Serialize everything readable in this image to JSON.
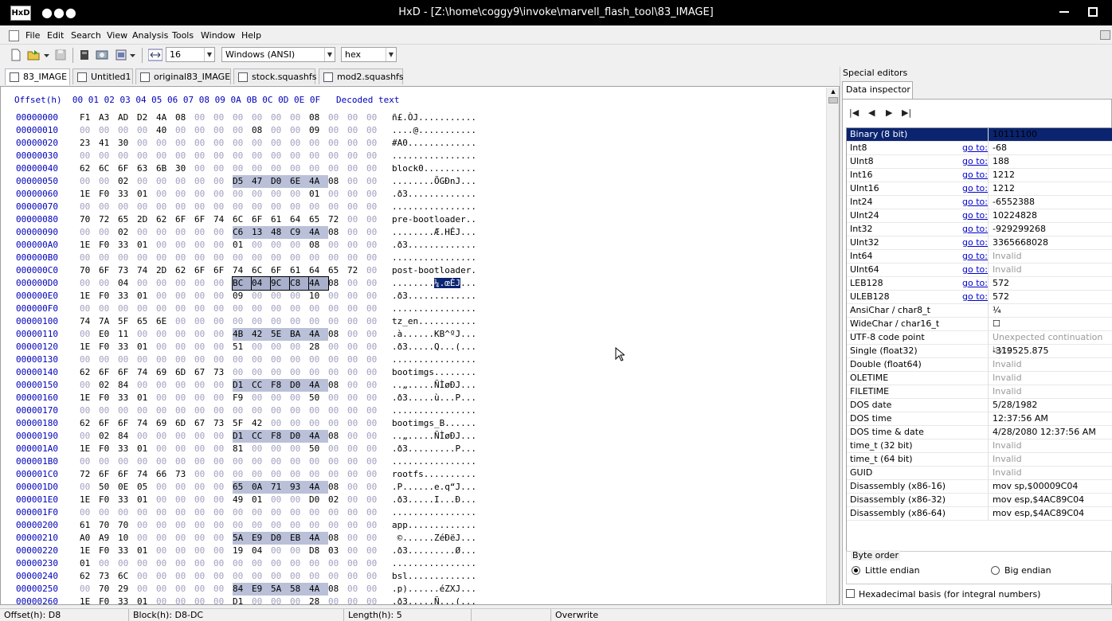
{
  "window": {
    "title": "HxD - [Z:\\home\\coggy9\\invoke\\marvell_flash_tool\\83_IMAGE]",
    "logo": "HxD"
  },
  "menu": [
    "File",
    "Edit",
    "Search",
    "View",
    "Analysis",
    "Tools",
    "Window",
    "Help"
  ],
  "toolbar": {
    "bytes_per_row": "16",
    "charset": "Windows (ANSI)",
    "offset_base": "hex"
  },
  "tabs": [
    "83_IMAGE",
    "Untitled1",
    "original83_IMAGE",
    "stock.squashfs",
    "mod2.squashfs"
  ],
  "hex": {
    "header": "Offset(h)  00 01 02 03 04 05 06 07 08 09 0A 0B 0C 0D 0E 0F   Decoded text",
    "rows": [
      {
        "o": "00000000",
        "b": "F1 A3 AD D2 4A 08 00 00 00 00 00 00 08 00 00 00",
        "t": "ñ£.ÒJ..........."
      },
      {
        "o": "00000010",
        "b": "00 00 00 00 40 00 00 00 00 08 00 00 09 00 00 00",
        "t": "....@..........."
      },
      {
        "o": "00000020",
        "b": "23 41 30 00 00 00 00 00 00 00 00 00 00 00 00 00",
        "t": "#A0............."
      },
      {
        "o": "00000030",
        "b": "00 00 00 00 00 00 00 00 00 00 00 00 00 00 00 00",
        "t": "................"
      },
      {
        "o": "00000040",
        "b": "62 6C 6F 63 6B 30 00 00 00 00 00 00 00 00 00 00",
        "t": "block0.........."
      },
      {
        "o": "00000050",
        "b": "00 00 02 00 00 00 00 00 D5 47 D0 6E 4A 08 00 00",
        "t": "........ÕGÐnJ...",
        "hl": [
          8,
          12
        ]
      },
      {
        "o": "00000060",
        "b": "1E F0 33 01 00 00 00 00 00 00 00 00 01 00 00 00",
        "t": ".ð3............."
      },
      {
        "o": "00000070",
        "b": "00 00 00 00 00 00 00 00 00 00 00 00 00 00 00 00",
        "t": "................"
      },
      {
        "o": "00000080",
        "b": "70 72 65 2D 62 6F 6F 74 6C 6F 61 64 65 72 00 00",
        "t": "pre-bootloader.."
      },
      {
        "o": "00000090",
        "b": "00 00 02 00 00 00 00 00 C6 13 48 C9 4A 08 00 00",
        "t": "........Æ.HÉJ...",
        "hl": [
          8,
          12
        ]
      },
      {
        "o": "000000A0",
        "b": "1E F0 33 01 00 00 00 00 01 00 00 00 08 00 00 00",
        "t": ".ð3............."
      },
      {
        "o": "000000B0",
        "b": "00 00 00 00 00 00 00 00 00 00 00 00 00 00 00 00",
        "t": "................"
      },
      {
        "o": "000000C0",
        "b": "70 6F 73 74 2D 62 6F 6F 74 6C 6F 61 64 65 72 00",
        "t": "post-bootloader."
      },
      {
        "o": "000000D0",
        "b": "00 00 04 00 00 00 00 00 BC 04 9C C8 4A 08 00 00",
        "t": "........¼.œÈJ...",
        "sel": [
          8,
          12
        ]
      },
      {
        "o": "000000E0",
        "b": "1E F0 33 01 00 00 00 00 09 00 00 00 10 00 00 00",
        "t": ".ð3............."
      },
      {
        "o": "000000F0",
        "b": "00 00 00 00 00 00 00 00 00 00 00 00 00 00 00 00",
        "t": "................"
      },
      {
        "o": "00000100",
        "b": "74 7A 5F 65 6E 00 00 00 00 00 00 00 00 00 00 00",
        "t": "tz_en..........."
      },
      {
        "o": "00000110",
        "b": "00 E0 11 00 00 00 00 00 4B 42 5E BA 4A 08 00 00",
        "t": ".à......KB^ºJ...",
        "hl": [
          8,
          12
        ]
      },
      {
        "o": "00000120",
        "b": "1E F0 33 01 00 00 00 00 51 00 00 00 28 00 00 00",
        "t": ".ð3.....Q...(..."
      },
      {
        "o": "00000130",
        "b": "00 00 00 00 00 00 00 00 00 00 00 00 00 00 00 00",
        "t": "................"
      },
      {
        "o": "00000140",
        "b": "62 6F 6F 74 69 6D 67 73 00 00 00 00 00 00 00 00",
        "t": "bootimgs........"
      },
      {
        "o": "00000150",
        "b": "00 02 84 00 00 00 00 00 D1 CC F8 D0 4A 08 00 00",
        "t": "..„.....ÑÌøÐJ...",
        "hl": [
          8,
          12
        ]
      },
      {
        "o": "00000160",
        "b": "1E F0 33 01 00 00 00 00 F9 00 00 00 50 00 00 00",
        "t": ".ð3.....ù...P..."
      },
      {
        "o": "00000170",
        "b": "00 00 00 00 00 00 00 00 00 00 00 00 00 00 00 00",
        "t": "................"
      },
      {
        "o": "00000180",
        "b": "62 6F 6F 74 69 6D 67 73 5F 42 00 00 00 00 00 00",
        "t": "bootimgs_B......"
      },
      {
        "o": "00000190",
        "b": "00 02 84 00 00 00 00 00 D1 CC F8 D0 4A 08 00 00",
        "t": "..„.....ÑÌøÐJ...",
        "hl": [
          8,
          12
        ]
      },
      {
        "o": "000001A0",
        "b": "1E F0 33 01 00 00 00 00 81 00 00 00 50 00 00 00",
        "t": ".ð3.........P..."
      },
      {
        "o": "000001B0",
        "b": "00 00 00 00 00 00 00 00 00 00 00 00 00 00 00 00",
        "t": "................"
      },
      {
        "o": "000001C0",
        "b": "72 6F 6F 74 66 73 00 00 00 00 00 00 00 00 00 00",
        "t": "rootfs.........."
      },
      {
        "o": "000001D0",
        "b": "00 50 0E 05 00 00 00 00 65 0A 71 93 4A 08 00 00",
        "t": ".P......e.q“J...",
        "hl": [
          8,
          12
        ]
      },
      {
        "o": "000001E0",
        "b": "1E F0 33 01 00 00 00 00 49 01 00 00 D0 02 00 00",
        "t": ".ð3.....I...Ð..."
      },
      {
        "o": "000001F0",
        "b": "00 00 00 00 00 00 00 00 00 00 00 00 00 00 00 00",
        "t": "................"
      },
      {
        "o": "00000200",
        "b": "61 70 70 00 00 00 00 00 00 00 00 00 00 00 00 00",
        "t": "app............."
      },
      {
        "o": "00000210",
        "b": "A0 A9 10 00 00 00 00 00 5A E9 D0 EB 4A 08 00 00",
        "t": " ©......ZéÐëJ...",
        "hl": [
          8,
          12
        ]
      },
      {
        "o": "00000220",
        "b": "1E F0 33 01 00 00 00 00 19 04 00 00 D8 03 00 00",
        "t": ".ð3.........Ø..."
      },
      {
        "o": "00000230",
        "b": "01 00 00 00 00 00 00 00 00 00 00 00 00 00 00 00",
        "t": "................"
      },
      {
        "o": "00000240",
        "b": "62 73 6C 00 00 00 00 00 00 00 00 00 00 00 00 00",
        "t": "bsl............."
      },
      {
        "o": "00000250",
        "b": "00 70 29 00 00 00 00 00 84 E9 5A 58 4A 08 00 00",
        "t": ".p)......éZXJ...",
        "hl": [
          8,
          12
        ]
      },
      {
        "o": "00000260",
        "b": "1E F0 33 01 00 00 00 00 D1 00 00 00 28 00 00 00",
        "t": ".ð3.....Ñ...(..."
      }
    ]
  },
  "special_editors": {
    "title": "Special editors",
    "tab": "Data inspector"
  },
  "inspector": [
    {
      "name": "Binary (8 bit)",
      "goto": "",
      "value": "10111100",
      "invalid": false
    },
    {
      "name": "Int8",
      "goto": "go to:",
      "value": "-68",
      "invalid": false
    },
    {
      "name": "UInt8",
      "goto": "go to:",
      "value": "188",
      "invalid": false
    },
    {
      "name": "Int16",
      "goto": "go to:",
      "value": "1212",
      "invalid": false
    },
    {
      "name": "UInt16",
      "goto": "go to:",
      "value": "1212",
      "invalid": false
    },
    {
      "name": "Int24",
      "goto": "go to:",
      "value": "-6552388",
      "invalid": false
    },
    {
      "name": "UInt24",
      "goto": "go to:",
      "value": "10224828",
      "invalid": false
    },
    {
      "name": "Int32",
      "goto": "go to:",
      "value": "-929299268",
      "invalid": false
    },
    {
      "name": "UInt32",
      "goto": "go to:",
      "value": "3365668028",
      "invalid": false
    },
    {
      "name": "Int64",
      "goto": "go to:",
      "value": "Invalid",
      "invalid": true
    },
    {
      "name": "UInt64",
      "goto": "go to:",
      "value": "Invalid",
      "invalid": true
    },
    {
      "name": "LEB128",
      "goto": "go to:",
      "value": "572",
      "invalid": false
    },
    {
      "name": "ULEB128",
      "goto": "go to:",
      "value": "572",
      "invalid": false
    },
    {
      "name": "AnsiChar / char8_t",
      "goto": "",
      "value": "¼",
      "invalid": false
    },
    {
      "name": "WideChar / char16_t",
      "goto": "",
      "value": "☐",
      "invalid": false
    },
    {
      "name": "UTF-8 code point",
      "goto": "",
      "value": "Unexpected continuation byte",
      "invalid": true
    },
    {
      "name": "Single (float32)",
      "goto": "",
      "value": "-319525.875",
      "invalid": false
    },
    {
      "name": "Double (float64)",
      "goto": "",
      "value": "Invalid",
      "invalid": true
    },
    {
      "name": "OLETIME",
      "goto": "",
      "value": "Invalid",
      "invalid": true
    },
    {
      "name": "FILETIME",
      "goto": "",
      "value": "Invalid",
      "invalid": true
    },
    {
      "name": "DOS date",
      "goto": "",
      "value": "5/28/1982",
      "invalid": false
    },
    {
      "name": "DOS time",
      "goto": "",
      "value": "12:37:56 AM",
      "invalid": false
    },
    {
      "name": "DOS time & date",
      "goto": "",
      "value": "4/28/2080 12:37:56 AM",
      "invalid": false
    },
    {
      "name": "time_t (32 bit)",
      "goto": "",
      "value": "Invalid",
      "invalid": true
    },
    {
      "name": "time_t (64 bit)",
      "goto": "",
      "value": "Invalid",
      "invalid": true
    },
    {
      "name": "GUID",
      "goto": "",
      "value": "Invalid",
      "invalid": true
    },
    {
      "name": "Disassembly (x86-16)",
      "goto": "",
      "value": "mov sp,$00009C04",
      "invalid": false
    },
    {
      "name": "Disassembly (x86-32)",
      "goto": "",
      "value": "mov esp,$4AC89C04",
      "invalid": false
    },
    {
      "name": "Disassembly (x86-64)",
      "goto": "",
      "value": "mov esp,$4AC89C04",
      "invalid": false
    }
  ],
  "byte_order": {
    "label": "Byte order",
    "little": "Little endian",
    "big": "Big endian",
    "selected": "little"
  },
  "hex_basis": "Hexadecimal basis (for integral numbers)",
  "status": {
    "offset": "Offset(h): D8",
    "block": "Block(h): D8-DC",
    "length": "Length(h): 5",
    "mode": "Overwrite"
  }
}
